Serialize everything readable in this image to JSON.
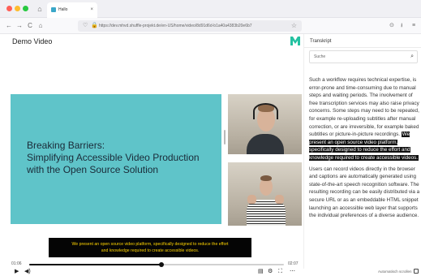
{
  "browser": {
    "tab_title": "Hallo",
    "tab_close": "×",
    "url": "https://dev.mhvd.shuffle-projekt.de/en-US/home/video/8d91d6d-b1a40a4383b20e6b7",
    "nav": {
      "back": "←",
      "forward": "→",
      "reload": "C",
      "home": "⌂",
      "shield": "♡",
      "lock": "🔒",
      "star": "☆",
      "pocket": "⊙",
      "download": "⭳",
      "menu": "≡"
    }
  },
  "page": {
    "title": "Demo Video",
    "logo_color": "#24c1a1"
  },
  "video": {
    "slide_bg": "#5fc4c9",
    "slide_heading": [
      "Breaking Barriers:",
      "Simplifying Accessible Video Production",
      "with the Open Source Solution"
    ],
    "subtitle_lines": [
      "We present an open source video platform, specifically designed to reduce the effort",
      "and knowledge required to create accessible videos."
    ],
    "current_time": "01:06",
    "duration": "02:07",
    "progress": 0.52,
    "controls": {
      "play": "▶",
      "volume": "◀)",
      "captions": "▤",
      "settings": "⚙",
      "fullscreen": "⛶",
      "speed": "⋯"
    }
  },
  "transcript": {
    "title": "Transkript",
    "search_placeholder": "Suche",
    "paragraph_1_before": "Such a workflow requires technical expertise, is error-prone and time-consuming due to manual steps and waiting periods.  The involvement of free transcription services may also raise privacy concerns.  Some steps may need to be repeated, for example re-uploading subtitles after manual correction,  or are irreversible, for example baked subtitles or picture-in-picture recordings. ",
    "paragraph_1_highlight": "We present an open source video platform, specifically designed to reduce the effort and knowledge required to create accessible videos.",
    "paragraph_2": "Users can record videos directly in the browser and captions are automatically generated using state-of-the-art speech recognition software.  The resulting recording can be easily distributed via a secure URL or as an embeddable HTML snippet launching an accessible web layer that supports the individual preferences of a diverse audience.",
    "auto_scroll_label": "Automatisch scrollen"
  }
}
